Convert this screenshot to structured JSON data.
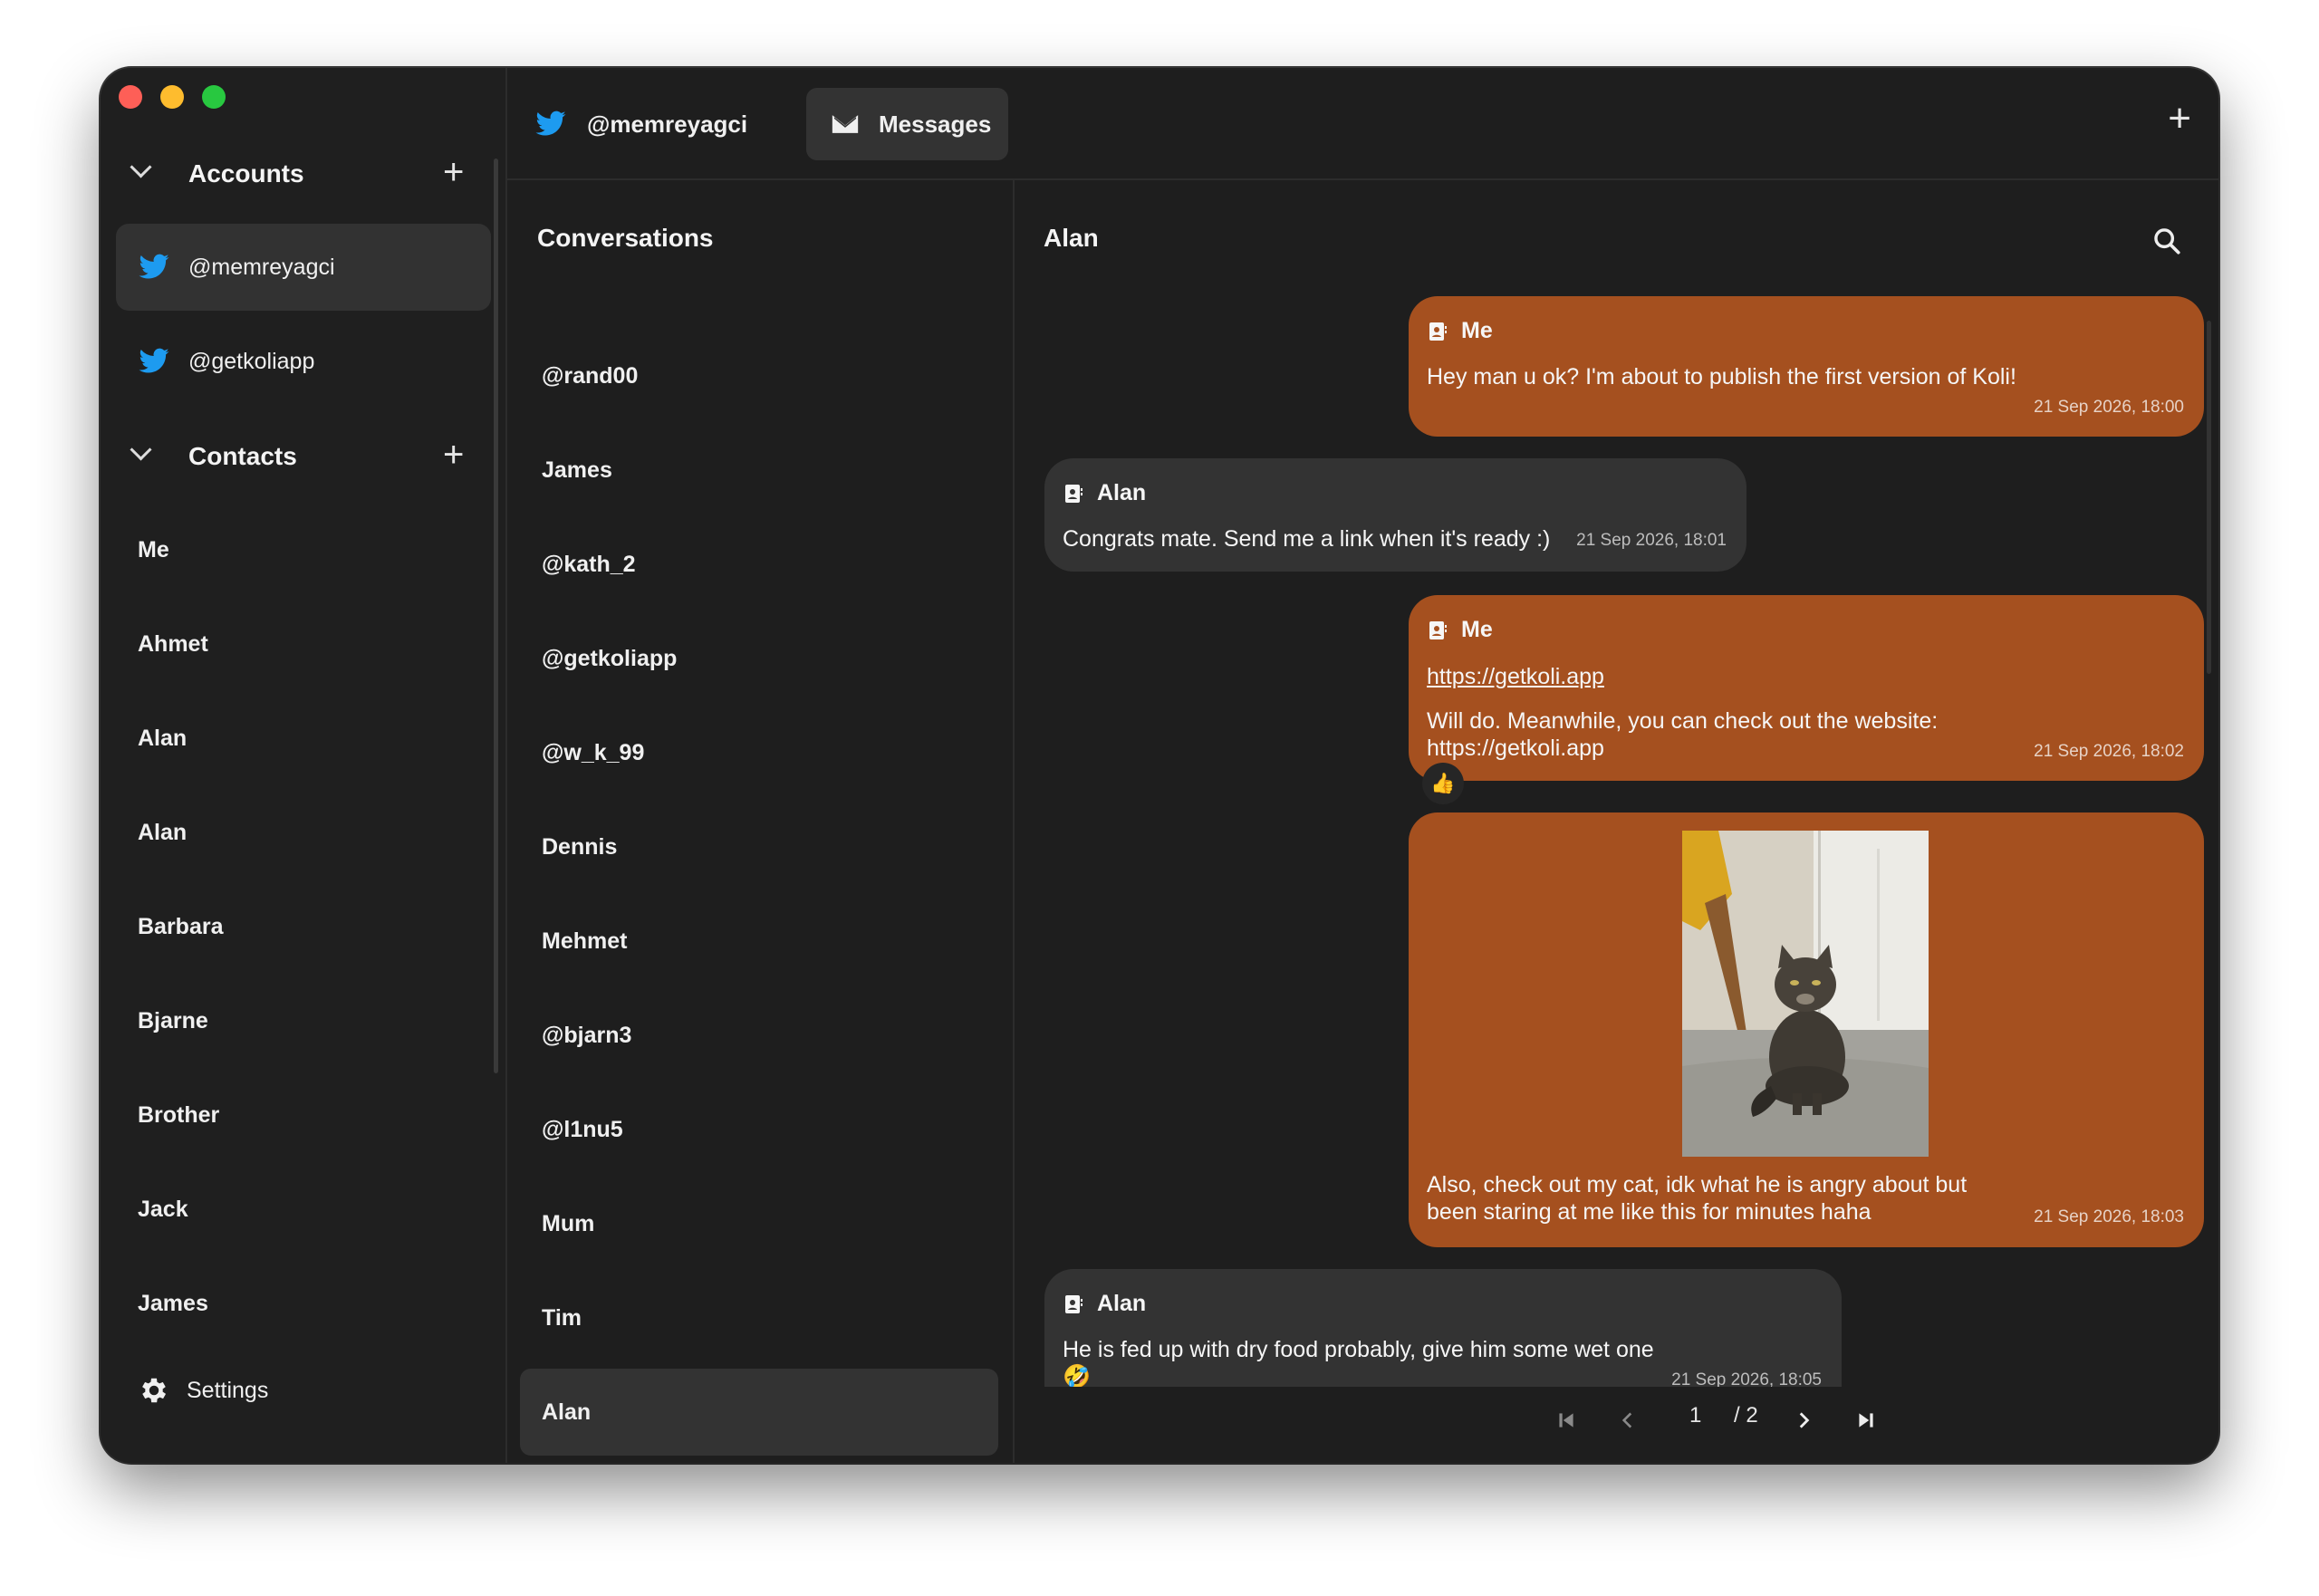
{
  "sidebar": {
    "accounts_title": "Accounts",
    "accounts": [
      {
        "handle": "@memreyagci",
        "active": true
      },
      {
        "handle": "@getkoliapp",
        "active": false
      }
    ],
    "contacts_title": "Contacts",
    "contacts": [
      "Me",
      "Ahmet",
      "Alan",
      "Alan",
      "Barbara",
      "Bjarne",
      "Brother",
      "Jack",
      "James"
    ],
    "settings_label": "Settings"
  },
  "topbar": {
    "account_tab": "@memreyagci",
    "messages_tab": "Messages"
  },
  "conversations": {
    "title": "Conversations",
    "items": [
      "@rand00",
      "James",
      "@kath_2",
      "@getkoliapp",
      "@w_k_99",
      "Dennis",
      "Mehmet",
      "@bjarn3",
      "@l1nu5",
      "Mum",
      "Tim",
      "Alan"
    ],
    "active": "Alan"
  },
  "chat": {
    "title": "Alan",
    "messages": [
      {
        "sender": "Me",
        "text": "Hey man u ok? I'm about to publish the first version of Koli!",
        "time": "21 Sep 2026, 18:00"
      },
      {
        "sender": "Alan",
        "text": "Congrats mate. Send me a link when it's ready :)",
        "time": "21 Sep 2026, 18:01"
      },
      {
        "sender": "Me",
        "link": "https://getkoli.app",
        "text": "Will do. Meanwhile, you can check out the website: https://getkoli.app",
        "time": "21 Sep 2026, 18:02",
        "reaction": "👍"
      },
      {
        "sender": "Me",
        "image": "cat-photo",
        "text": "Also, check out my cat, idk what he is angry about but been staring at me like this for minutes haha",
        "time": "21 Sep 2026, 18:03"
      },
      {
        "sender": "Alan",
        "text": "He is fed up with dry food probably, give him some wet one 🤣",
        "time": "21 Sep 2026, 18:05"
      }
    ]
  },
  "pagination": {
    "current": "1",
    "total": "/ 2"
  },
  "colors": {
    "accent_bubble": "#a5501f",
    "twitter_blue": "#1d9bf0",
    "window_bg": "#1e1e1e"
  }
}
